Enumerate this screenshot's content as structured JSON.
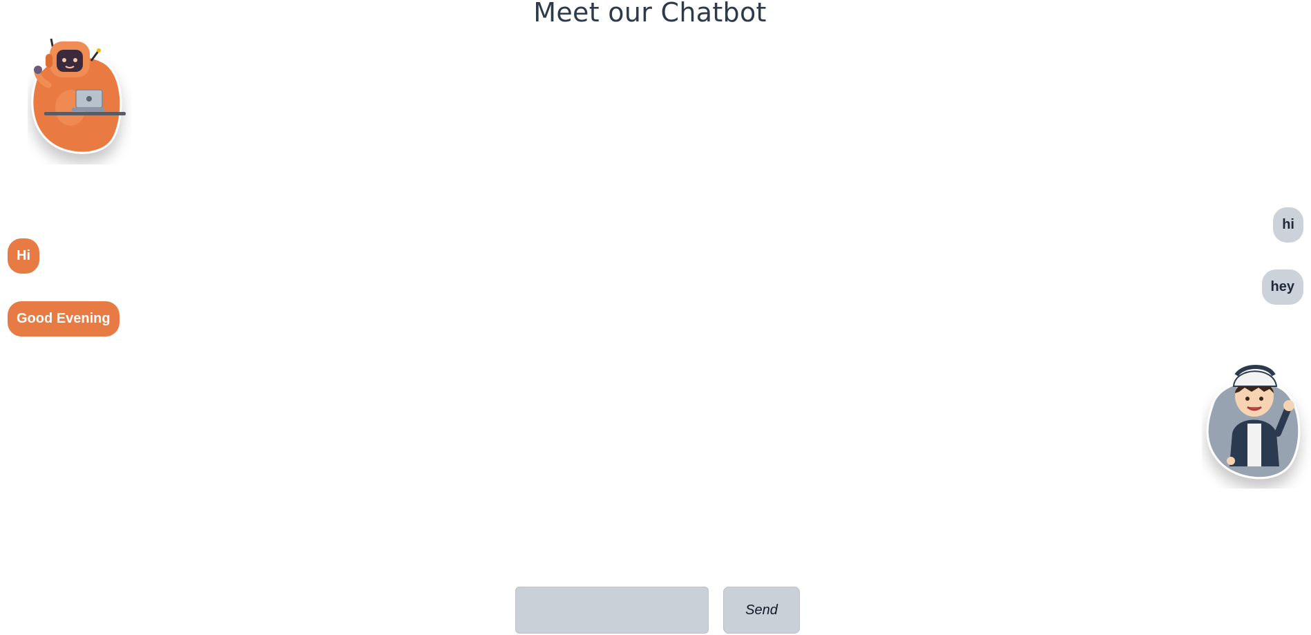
{
  "header": {
    "title": "Meet our Chatbot"
  },
  "avatars": {
    "bot": "robot-with-laptop-icon",
    "user": "waving-boy-with-cap-icon"
  },
  "colors": {
    "bot_bubble": "#e87a43",
    "user_bubble": "#cbd2da",
    "title": "#2d3a4a",
    "input_bg": "#c9d0d8"
  },
  "messages": {
    "bot": [
      "Hi",
      "Good Evening"
    ],
    "user": [
      "hi",
      "hey"
    ]
  },
  "composer": {
    "input_value": "",
    "send_label": "Send"
  }
}
